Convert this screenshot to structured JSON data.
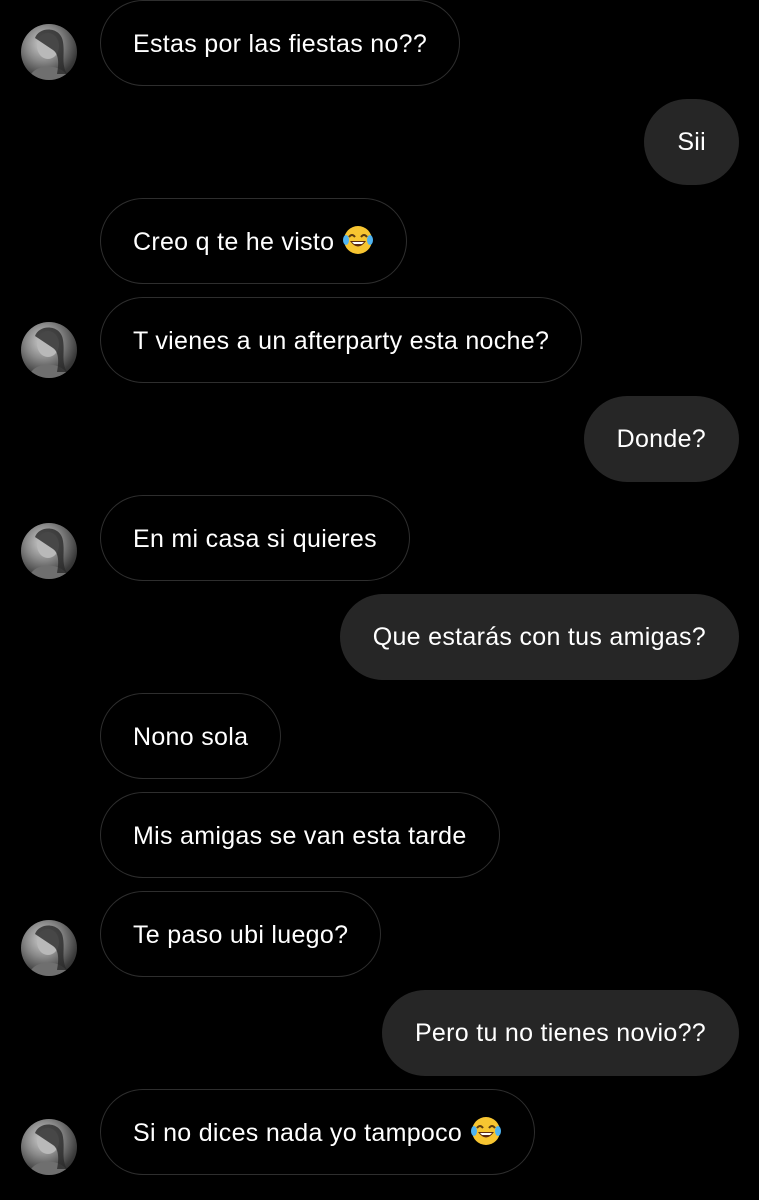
{
  "thread": {
    "messages": [
      {
        "sender": "them",
        "text": "Estas por las fiestas no??",
        "avatar": true
      },
      {
        "sender": "me",
        "text": "Sii"
      },
      {
        "sender": "them",
        "text": "Creo q te he visto",
        "emoji": "laughing-tears-emoji"
      },
      {
        "sender": "them",
        "text": "T vienes a un afterparty esta noche?",
        "avatar": true
      },
      {
        "sender": "me",
        "text": "Donde?"
      },
      {
        "sender": "them",
        "text": "En mi casa si quieres",
        "avatar": true
      },
      {
        "sender": "me",
        "text": "Que estarás con tus amigas?"
      },
      {
        "sender": "them",
        "text": "Nono sola"
      },
      {
        "sender": "them",
        "text": "Mis amigas se van esta tarde"
      },
      {
        "sender": "them",
        "text": "Te paso ubi luego?",
        "avatar": true
      },
      {
        "sender": "me",
        "text": "Pero tu no tienes novio??"
      },
      {
        "sender": "them",
        "text": "Si no dices nada yo tampoco",
        "emoji": "laughing-tears-emoji",
        "avatar": true
      }
    ]
  },
  "colors": {
    "background": "#000000",
    "incoming_border": "#2e2e2e",
    "outgoing_bubble": "#262626",
    "text": "#ffffff"
  }
}
